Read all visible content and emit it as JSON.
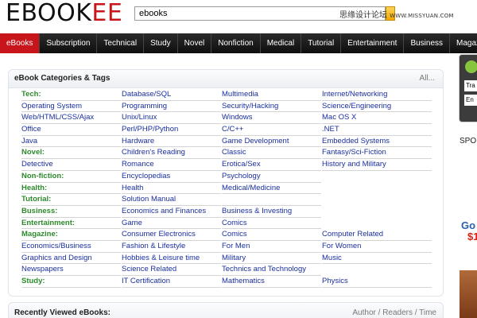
{
  "header": {
    "logo_main": "EBOOK",
    "logo_accent": "EE",
    "search_value": "ebooks",
    "watermark_cn": "思缘设计论坛",
    "watermark_url": "WWW.MISSYUAN.COM"
  },
  "nav": {
    "items": [
      "eBooks",
      "Subscription",
      "Technical",
      "Study",
      "Novel",
      "Nonfiction",
      "Medical",
      "Tutorial",
      "Entertainment",
      "Business",
      "Magazine"
    ]
  },
  "categories": {
    "title": "eBook Categories & Tags",
    "all_link": "All...",
    "rows": [
      [
        "Tech:",
        "Database/SQL",
        "Multimedia",
        "Internet/Networking"
      ],
      [
        "Operating System",
        "Programming",
        "Security/Hacking",
        "Science/Engineering"
      ],
      [
        "Web/HTML/CSS/Ajax",
        "Unix/Linux",
        "Windows",
        "Mac OS X"
      ],
      [
        "Office",
        "Perl/PHP/Python",
        "C/C++",
        ".NET"
      ],
      [
        "Java",
        "Hardware",
        "Game Development",
        "Embedded Systems"
      ],
      [
        "Novel:",
        "Children's Reading",
        "Classic",
        "Fantasy/Sci-Fiction"
      ],
      [
        "Detective",
        "Romance",
        "Erotica/Sex",
        "History and Military"
      ],
      [
        "Non-fiction:",
        "Encyclopedias",
        "Psychology",
        ""
      ],
      [
        "Health:",
        "Health",
        "Medical/Medicine",
        ""
      ],
      [
        "Tutorial:",
        "Solution Manual",
        "",
        ""
      ],
      [
        "Business:",
        "Economics and Finances",
        "Business & Investing",
        ""
      ],
      [
        "Entertainment:",
        "Game",
        "Comics",
        ""
      ],
      [
        "Magazine:",
        "Consumer Electronics",
        "Comics",
        "Computer Related"
      ],
      [
        "Economics/Business",
        "Fashion & Lifestyle",
        "For Men",
        "For Women"
      ],
      [
        "Graphics and Design",
        "Hobbies & Leisure time",
        "Military",
        "Music"
      ],
      [
        "Newspapers",
        "Science Related",
        "Technics and Technology",
        ""
      ],
      [
        "Study:",
        "IT Certification",
        "Mathematics",
        "Physics"
      ]
    ]
  },
  "recent": {
    "title": "Recently Viewed eBooks:",
    "sort_label": "Author / Readers / Time"
  },
  "sidebar": {
    "input1": "Tra",
    "input2": "En",
    "spo": "SPO",
    "go": "Go",
    "price": "$1"
  }
}
